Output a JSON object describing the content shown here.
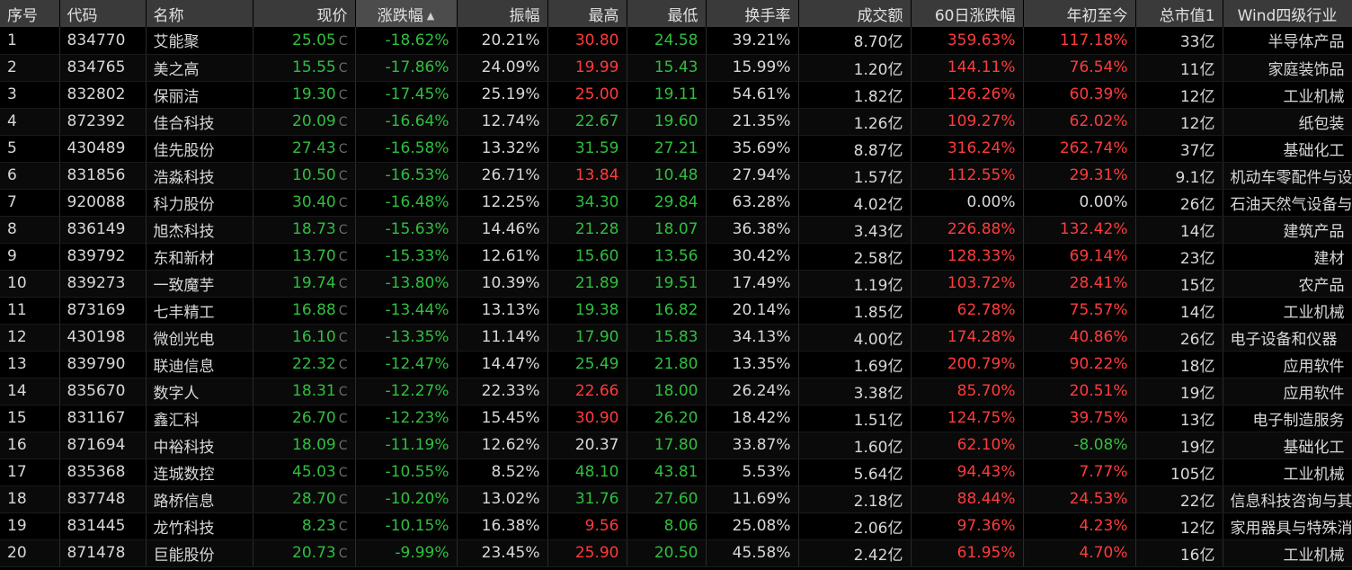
{
  "headers": {
    "index": "序号",
    "code": "代码",
    "name": "名称",
    "price": "现价",
    "change_pct": "涨跌幅",
    "amplitude": "振幅",
    "high": "最高",
    "low": "最低",
    "turnover": "换手率",
    "volume_amount": "成交额",
    "change_60d": "60日涨跌幅",
    "ytd": "年初至今",
    "market_cap": "总市值1",
    "industry": "Wind四级行业"
  },
  "sort_indicator": "▲",
  "price_flag": "C",
  "colors": {
    "up": "#ff3b3b",
    "down": "#2fbf3f",
    "neutral": "#d8d8d8",
    "header_bg": "#3a3a3a"
  },
  "rows": [
    {
      "idx": "1",
      "code": "834770",
      "name": "艾能聚",
      "price": "25.05",
      "chg": "-18.62%",
      "amp": "20.21%",
      "high": "30.80",
      "low": "24.58",
      "turn": "39.21%",
      "amount": "8.70亿",
      "chg60": "359.63%",
      "ytd": "117.18%",
      "cap": "33亿",
      "ind": "半导体产品"
    },
    {
      "idx": "2",
      "code": "834765",
      "name": "美之高",
      "price": "15.55",
      "chg": "-17.86%",
      "amp": "24.09%",
      "high": "19.99",
      "low": "15.43",
      "turn": "15.99%",
      "amount": "1.20亿",
      "chg60": "144.11%",
      "ytd": "76.54%",
      "cap": "11亿",
      "ind": "家庭装饰品"
    },
    {
      "idx": "3",
      "code": "832802",
      "name": "保丽洁",
      "price": "19.30",
      "chg": "-17.45%",
      "amp": "25.19%",
      "high": "25.00",
      "low": "19.11",
      "turn": "54.61%",
      "amount": "1.82亿",
      "chg60": "126.26%",
      "ytd": "60.39%",
      "cap": "12亿",
      "ind": "工业机械"
    },
    {
      "idx": "4",
      "code": "872392",
      "name": "佳合科技",
      "price": "20.09",
      "chg": "-16.64%",
      "amp": "12.74%",
      "high": "22.67",
      "low": "19.60",
      "turn": "21.35%",
      "amount": "1.26亿",
      "chg60": "109.27%",
      "ytd": "62.02%",
      "cap": "12亿",
      "ind": "纸包装"
    },
    {
      "idx": "5",
      "code": "430489",
      "name": "佳先股份",
      "price": "27.43",
      "chg": "-16.58%",
      "amp": "13.32%",
      "high": "31.59",
      "low": "27.21",
      "turn": "35.69%",
      "amount": "8.87亿",
      "chg60": "316.24%",
      "ytd": "262.74%",
      "cap": "37亿",
      "ind": "基础化工"
    },
    {
      "idx": "6",
      "code": "831856",
      "name": "浩淼科技",
      "price": "10.50",
      "chg": "-16.53%",
      "amp": "26.71%",
      "high": "13.84",
      "low": "10.48",
      "turn": "27.94%",
      "amount": "1.57亿",
      "chg60": "112.55%",
      "ytd": "29.31%",
      "cap": "9.1亿",
      "ind": "机动车零配件与设备"
    },
    {
      "idx": "7",
      "code": "920088",
      "name": "科力股份",
      "price": "30.40",
      "chg": "-16.48%",
      "amp": "12.25%",
      "high": "34.30",
      "low": "29.84",
      "turn": "63.28%",
      "amount": "4.02亿",
      "chg60": "0.00%",
      "ytd": "0.00%",
      "cap": "26亿",
      "ind": "石油天然气设备与服务"
    },
    {
      "idx": "8",
      "code": "836149",
      "name": "旭杰科技",
      "price": "18.73",
      "chg": "-15.63%",
      "amp": "14.46%",
      "high": "21.28",
      "low": "18.07",
      "turn": "36.38%",
      "amount": "3.43亿",
      "chg60": "226.88%",
      "ytd": "132.42%",
      "cap": "14亿",
      "ind": "建筑产品"
    },
    {
      "idx": "9",
      "code": "839792",
      "name": "东和新材",
      "price": "13.70",
      "chg": "-15.33%",
      "amp": "12.61%",
      "high": "15.60",
      "low": "13.56",
      "turn": "30.42%",
      "amount": "2.58亿",
      "chg60": "128.33%",
      "ytd": "69.14%",
      "cap": "23亿",
      "ind": "建材"
    },
    {
      "idx": "10",
      "code": "839273",
      "name": "一致魔芋",
      "price": "19.74",
      "chg": "-13.80%",
      "amp": "10.39%",
      "high": "21.89",
      "low": "19.51",
      "turn": "17.49%",
      "amount": "1.19亿",
      "chg60": "103.72%",
      "ytd": "28.41%",
      "cap": "15亿",
      "ind": "农产品"
    },
    {
      "idx": "11",
      "code": "873169",
      "name": "七丰精工",
      "price": "16.88",
      "chg": "-13.44%",
      "amp": "13.13%",
      "high": "19.38",
      "low": "16.82",
      "turn": "20.14%",
      "amount": "1.85亿",
      "chg60": "62.78%",
      "ytd": "75.57%",
      "cap": "14亿",
      "ind": "工业机械"
    },
    {
      "idx": "12",
      "code": "430198",
      "name": "微创光电",
      "price": "16.10",
      "chg": "-13.35%",
      "amp": "11.14%",
      "high": "17.90",
      "low": "15.83",
      "turn": "34.13%",
      "amount": "4.00亿",
      "chg60": "174.28%",
      "ytd": "40.86%",
      "cap": "26亿",
      "ind": "电子设备和仪器"
    },
    {
      "idx": "13",
      "code": "839790",
      "name": "联迪信息",
      "price": "22.32",
      "chg": "-12.47%",
      "amp": "14.47%",
      "high": "25.49",
      "low": "21.80",
      "turn": "13.35%",
      "amount": "1.69亿",
      "chg60": "200.79%",
      "ytd": "90.22%",
      "cap": "18亿",
      "ind": "应用软件"
    },
    {
      "idx": "14",
      "code": "835670",
      "name": "数字人",
      "price": "18.31",
      "chg": "-12.27%",
      "amp": "22.33%",
      "high": "22.66",
      "low": "18.00",
      "turn": "26.24%",
      "amount": "3.38亿",
      "chg60": "85.70%",
      "ytd": "20.51%",
      "cap": "19亿",
      "ind": "应用软件"
    },
    {
      "idx": "15",
      "code": "831167",
      "name": "鑫汇科",
      "price": "26.70",
      "chg": "-12.23%",
      "amp": "15.45%",
      "high": "30.90",
      "low": "26.20",
      "turn": "18.42%",
      "amount": "1.51亿",
      "chg60": "124.75%",
      "ytd": "39.75%",
      "cap": "13亿",
      "ind": "电子制造服务"
    },
    {
      "idx": "16",
      "code": "871694",
      "name": "中裕科技",
      "price": "18.09",
      "chg": "-11.19%",
      "amp": "12.62%",
      "high": "20.37",
      "low": "17.80",
      "turn": "33.87%",
      "amount": "1.60亿",
      "chg60": "62.10%",
      "ytd": "-8.08%",
      "cap": "19亿",
      "ind": "基础化工"
    },
    {
      "idx": "17",
      "code": "835368",
      "name": "连城数控",
      "price": "45.03",
      "chg": "-10.55%",
      "amp": "8.52%",
      "high": "48.10",
      "low": "43.81",
      "turn": "5.53%",
      "amount": "5.64亿",
      "chg60": "94.43%",
      "ytd": "7.77%",
      "cap": "105亿",
      "ind": "工业机械"
    },
    {
      "idx": "18",
      "code": "837748",
      "name": "路桥信息",
      "price": "28.70",
      "chg": "-10.20%",
      "amp": "13.02%",
      "high": "31.76",
      "low": "27.60",
      "turn": "11.69%",
      "amount": "2.18亿",
      "chg60": "88.44%",
      "ytd": "24.53%",
      "cap": "22亿",
      "ind": "信息科技咨询与其它服务"
    },
    {
      "idx": "19",
      "code": "831445",
      "name": "龙竹科技",
      "price": "8.23",
      "chg": "-10.15%",
      "amp": "16.38%",
      "high": "9.56",
      "low": "8.06",
      "turn": "25.08%",
      "amount": "2.06亿",
      "chg60": "97.36%",
      "ytd": "4.23%",
      "cap": "12亿",
      "ind": "家用器具与特殊消费品"
    },
    {
      "idx": "20",
      "code": "871478",
      "name": "巨能股份",
      "price": "20.73",
      "chg": "-9.99%",
      "amp": "23.45%",
      "high": "25.90",
      "low": "20.50",
      "turn": "45.58%",
      "amount": "2.42亿",
      "chg60": "61.95%",
      "ytd": "4.70%",
      "cap": "16亿",
      "ind": "工业机械"
    }
  ],
  "prev_close_note": "Colors for high/low relative to previous close per row",
  "row_colors": [
    {
      "high": "up",
      "low": "dn"
    },
    {
      "high": "up",
      "low": "dn"
    },
    {
      "high": "up",
      "low": "dn"
    },
    {
      "high": "dn",
      "low": "dn"
    },
    {
      "high": "dn",
      "low": "dn"
    },
    {
      "high": "up",
      "low": "dn"
    },
    {
      "high": "dn",
      "low": "dn"
    },
    {
      "high": "dn",
      "low": "dn"
    },
    {
      "high": "dn",
      "low": "dn"
    },
    {
      "high": "dn",
      "low": "dn"
    },
    {
      "high": "dn",
      "low": "dn"
    },
    {
      "high": "dn",
      "low": "dn"
    },
    {
      "high": "dn",
      "low": "dn"
    },
    {
      "high": "up",
      "low": "dn"
    },
    {
      "high": "up",
      "low": "dn"
    },
    {
      "high": "nt",
      "low": "dn"
    },
    {
      "high": "dn",
      "low": "dn"
    },
    {
      "high": "dn",
      "low": "dn"
    },
    {
      "high": "up",
      "low": "dn"
    },
    {
      "high": "up",
      "low": "dn"
    }
  ]
}
